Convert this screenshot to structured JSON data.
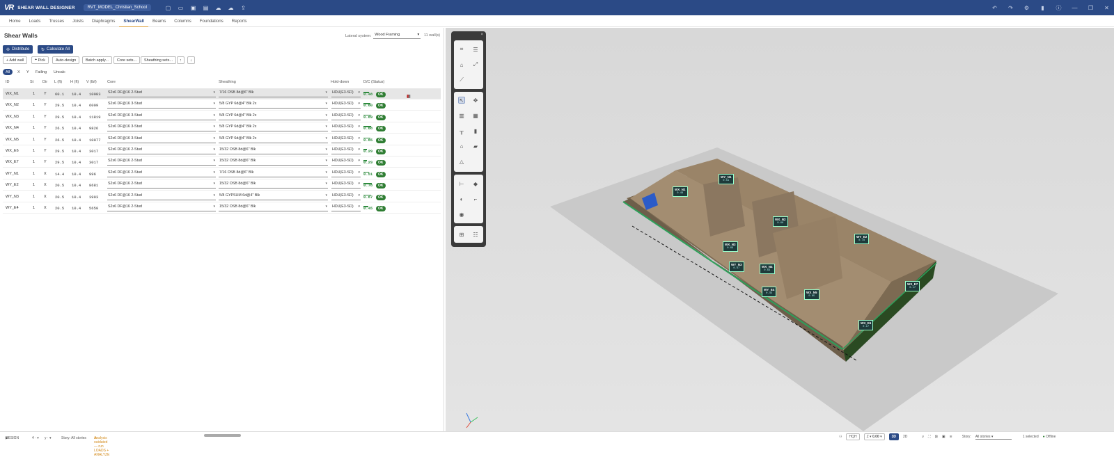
{
  "app": {
    "logo": "VR",
    "name": "SHEAR WALL DESIGNER",
    "project": "RVT_MODEL_Christian_School"
  },
  "menus": [
    "Home",
    "Loads",
    "Trusses",
    "Joists",
    "Diaphragms",
    "ShearWall",
    "Beams",
    "Columns",
    "Foundations",
    "Reports"
  ],
  "active_menu": "ShearWall",
  "panel": {
    "title": "Shear Walls",
    "lateral_label": "Lateral system:",
    "lateral_value": "Wood Framing",
    "wall_count": "11 wall(s)"
  },
  "actions": {
    "distribute": "Distribute",
    "calculate_all": "Calculate All"
  },
  "toolbar": [
    "+ Add wall",
    "Pick",
    "Auto-design",
    "Batch apply...",
    "Core sets...",
    "Sheathing sets..."
  ],
  "filters": [
    "All",
    "X",
    "Y",
    "Failing",
    "Uncalc"
  ],
  "columns": {
    "id": "ID",
    "st": "St",
    "dir": "Dir",
    "l": "L (ft)",
    "h": "H (ft)",
    "v": "V (lbf)",
    "core": "Core",
    "sheathing": "Sheathing",
    "holddown": "Hold-down",
    "dc": "D/C (Status)"
  },
  "rows": [
    {
      "id": "WX_N1",
      "st": "1",
      "dir": "Y",
      "l": "60.1",
      "h": "10.4",
      "v": "10083",
      "core": "S2x6 DF@16 2-Stud",
      "sheathing": "7/16 OSB 8d@6\" Blk",
      "hd": "HDU(E3-SD)",
      "dc": "0.48",
      "ratio": 0.48,
      "status": "OK"
    },
    {
      "id": "WX_N2",
      "st": "1",
      "dir": "Y",
      "l": "29.5",
      "h": "10.4",
      "v": "6009",
      "core": "S2x6 DF@16 3-Stud",
      "sheathing": "5/8 GYP 6d@4\" Blk 2x",
      "hd": "HDU(E3-SD)",
      "dc": "0.60",
      "ratio": 0.6,
      "status": "OK"
    },
    {
      "id": "WX_N3",
      "st": "1",
      "dir": "Y",
      "l": "29.5",
      "h": "10.4",
      "v": "11819",
      "core": "S2x6 DF@16 3-Stud",
      "sheathing": "5/8 GYP 6d@4\" Blk 2x",
      "hd": "HDU(E3-SD)",
      "dc": "0.69",
      "ratio": 0.69,
      "status": "OK"
    },
    {
      "id": "WX_N4",
      "st": "1",
      "dir": "Y",
      "l": "26.5",
      "h": "10.4",
      "v": "9826",
      "core": "S2x6 DF@16 3-Stud",
      "sheathing": "5/8 GYP 6d@4\" Blk 2x",
      "hd": "HDU(E3-SD)",
      "dc": "0.68",
      "ratio": 0.68,
      "status": "OK"
    },
    {
      "id": "WX_N5",
      "st": "1",
      "dir": "Y",
      "l": "26.5",
      "h": "10.4",
      "v": "10077",
      "core": "S2x6 DF@16 3-Stud",
      "sheathing": "5/8 GYP 6d@4\" Blk 2x",
      "hd": "HDU(E3-SD)",
      "dc": "0.65",
      "ratio": 0.65,
      "status": "OK"
    },
    {
      "id": "WX_E6",
      "st": "1",
      "dir": "Y",
      "l": "29.5",
      "h": "10.4",
      "v": "3017",
      "core": "S2x6 DF@16 2-Stud",
      "sheathing": "15/32 OSB 8d@6\" Blk",
      "hd": "HDU(E3-SD)",
      "dc": "0.29",
      "ratio": 0.29,
      "status": "OK"
    },
    {
      "id": "WX_E7",
      "st": "1",
      "dir": "Y",
      "l": "29.5",
      "h": "10.4",
      "v": "3017",
      "core": "S2x6 DF@16 2-Stud",
      "sheathing": "15/32 OSB 8d@6\" Blk",
      "hd": "HDU(E3-SD)",
      "dc": "0.29",
      "ratio": 0.29,
      "status": "OK"
    },
    {
      "id": "WY_N1",
      "st": "1",
      "dir": "X",
      "l": "14.4",
      "h": "10.4",
      "v": "996",
      "core": "S2x6 DF@16 2-Stud",
      "sheathing": "7/16 OSB 8d@6\" Blk",
      "hd": "HDU(E3-SD)",
      "dc": "0.51",
      "ratio": 0.51,
      "status": "OK"
    },
    {
      "id": "WY_E2",
      "st": "1",
      "dir": "X",
      "l": "20.5",
      "h": "10.4",
      "v": "8681",
      "core": "S2x6 DF@16 2-Stud",
      "sheathing": "15/32 OSB 8d@6\" Blk",
      "hd": "HDU(E3-SD)",
      "dc": "0.78",
      "ratio": 0.78,
      "status": "OK"
    },
    {
      "id": "WY_N3",
      "st": "1",
      "dir": "X",
      "l": "20.5",
      "h": "10.4",
      "v": "3993",
      "core": "S2x6 DF@16 2-Stud",
      "sheathing": "5/8 GYPSUM 6d@4\" Blk",
      "hd": "HDU(E3-SD)",
      "dc": "0.67",
      "ratio": 0.67,
      "status": "OK"
    },
    {
      "id": "WY_E4",
      "st": "1",
      "dir": "X",
      "l": "20.5",
      "h": "10.4",
      "v": "5650",
      "core": "S2x6 DF@16 2-Stud",
      "sheathing": "15/32 OSB 8d@6\" Blk",
      "hd": "HDU(E3-SD)",
      "dc": "0.45",
      "ratio": 0.45,
      "status": "OK"
    }
  ],
  "model_labels": [
    {
      "id": "WX_N1",
      "dc": "0.48"
    },
    {
      "id": "WY_N1",
      "dc": "0.51"
    },
    {
      "id": "WX_N2",
      "dc": "0.60"
    },
    {
      "id": "WY_E2",
      "dc": "0.78"
    },
    {
      "id": "WX_N3",
      "dc": "0.69"
    },
    {
      "id": "WY_N3",
      "dc": "0.67"
    },
    {
      "id": "WX_N4",
      "dc": "0.63"
    },
    {
      "id": "WY_E4",
      "dc": "0.45"
    },
    {
      "id": "WX_N5",
      "dc": "0.65"
    },
    {
      "id": "WX_E7",
      "dc": "0.17"
    },
    {
      "id": "WX_E6",
      "dc": "0.17"
    }
  ],
  "status": {
    "mode": "DESIGN",
    "story": "Story: All stories",
    "warning": "Analysis outdated — run LOADS + ANALYZE"
  },
  "viewport": {
    "hqh": "HQH",
    "z_label": "Z",
    "z_value": "0.00",
    "view_3d": "3D",
    "view_2d": "2D",
    "story_label": "Story:",
    "story_value": "All stories",
    "selected": "1 selected",
    "online": "Offline"
  },
  "colors": {
    "brand": "#2b4a86",
    "ok": "#2e7d32",
    "accent": "#e0a23a"
  }
}
